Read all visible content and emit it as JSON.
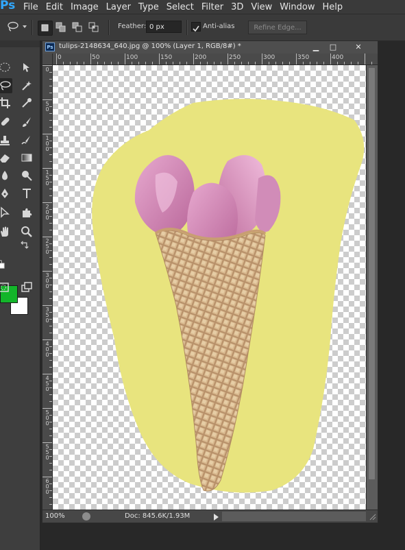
{
  "app": {
    "logo": "Ps"
  },
  "menu": [
    "File",
    "Edit",
    "Image",
    "Layer",
    "Type",
    "Select",
    "Filter",
    "3D",
    "View",
    "Window",
    "Help"
  ],
  "options": {
    "feather_label": "Feather:",
    "feather_value": "0 px",
    "antialias_label": "Anti-alias",
    "antialias_checked": true,
    "refine_label": "Refine Edge..."
  },
  "document": {
    "icon_text": "Ps",
    "title": "tulips-2148634_640.jpg @ 100% (Layer 1, RGB/8#) *",
    "buttons": {
      "minimize": "▁",
      "restore": "□",
      "close": "✕"
    },
    "ruler_h": [
      "0",
      "50",
      "100",
      "150",
      "200",
      "250",
      "300",
      "350",
      "400"
    ],
    "ruler_v": [
      "0",
      "5 0",
      "1 0 0",
      "1 5 0",
      "2 0 0",
      "2 5 0",
      "3 0 0",
      "3 5 0",
      "4 0 0",
      "4 5 0",
      "5 0 0",
      "5 5 0",
      "6 0 0"
    ]
  },
  "status": {
    "zoom": "100%",
    "doc_info": "Doc: 845.6K/1.93M"
  },
  "colors": {
    "foreground": "#13b52a",
    "background": "#ffffff",
    "backdrop_yellow": "#e8e47e",
    "tulip_pink": "#d98fbc",
    "cone": "#d4b286"
  }
}
